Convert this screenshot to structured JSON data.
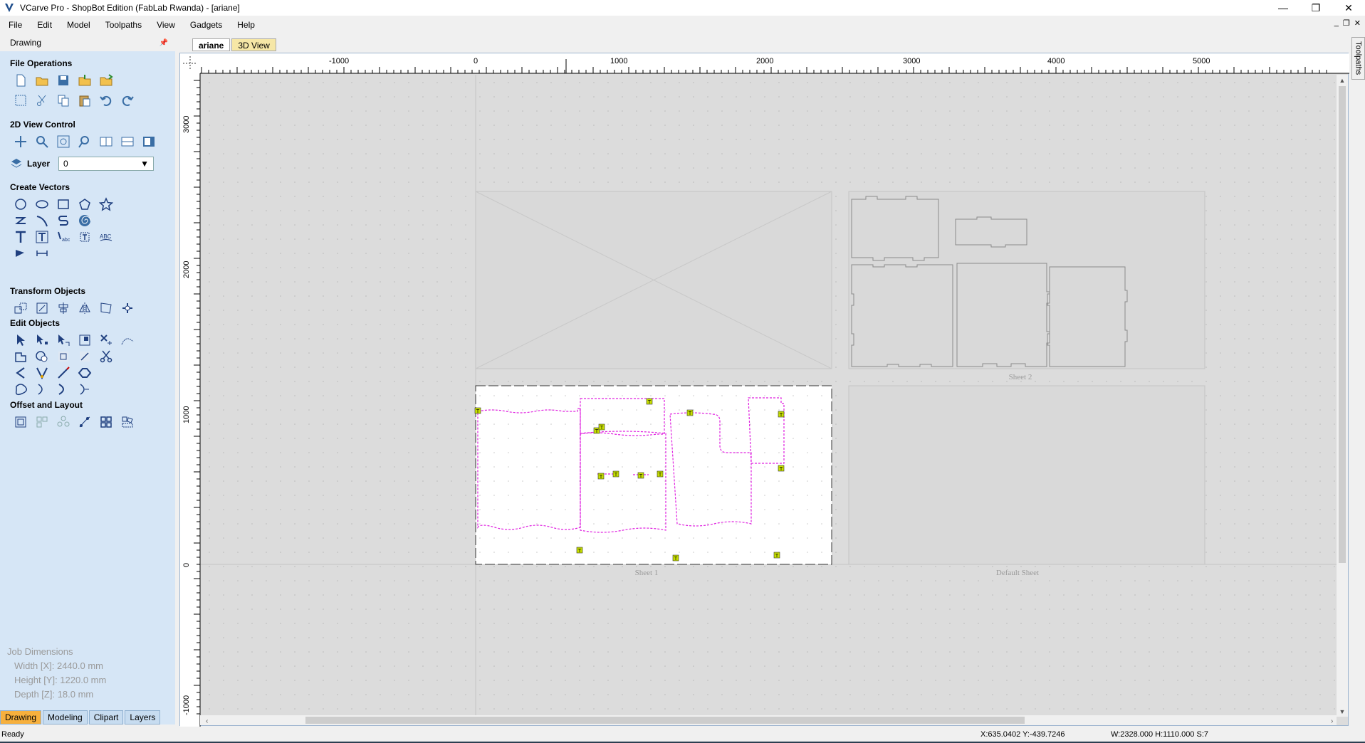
{
  "window": {
    "title": "VCarve Pro - ShopBot Edition (FabLab Rwanda) - [ariane]",
    "controls": [
      "—",
      "❐",
      "✕"
    ]
  },
  "menu": [
    "File",
    "Edit",
    "Model",
    "Toolpaths",
    "View",
    "Gadgets",
    "Help"
  ],
  "mdi_controls": [
    "_",
    "❐",
    "✕"
  ],
  "panel": {
    "title": "Drawing",
    "sections": {
      "file_ops": "File Operations",
      "view_control": "2D View Control",
      "create_vectors": "Create Vectors",
      "transform": "Transform Objects",
      "edit": "Edit Objects",
      "offset_layout": "Offset and Layout"
    },
    "layer_label": "Layer",
    "layer_value": "0",
    "job": {
      "heading": "Job Dimensions",
      "width": "Width  [X]: 2440.0 mm",
      "height": "Height [Y]: 1220.0 mm",
      "depth": "Depth  [Z]: 18.0 mm"
    },
    "bottom_tabs": [
      "Drawing",
      "Modeling",
      "Clipart",
      "Layers"
    ]
  },
  "doc_tabs": [
    "ariane",
    "3D View"
  ],
  "right_tab": "Toolpaths",
  "canvas": {
    "ruler_top": [
      "-1000",
      "0",
      "1000",
      "2000",
      "3000",
      "4000",
      "5000"
    ],
    "ruler_left": [
      "3000",
      "2000",
      "1000",
      "0",
      "-1000"
    ],
    "sheet_labels": [
      "Sheet 2",
      "Sheet 1",
      "Default Sheet"
    ],
    "marker_label": "T",
    "colors": {
      "selected_vectors": "#e020e0",
      "marker": "#c8e000",
      "sheet_bg": "#dcdcdc"
    }
  },
  "status": {
    "ready": "Ready",
    "coords": "X:635.0402 Y:-439.7246",
    "dims": "W:2328.000  H:1110.000  S:7"
  }
}
